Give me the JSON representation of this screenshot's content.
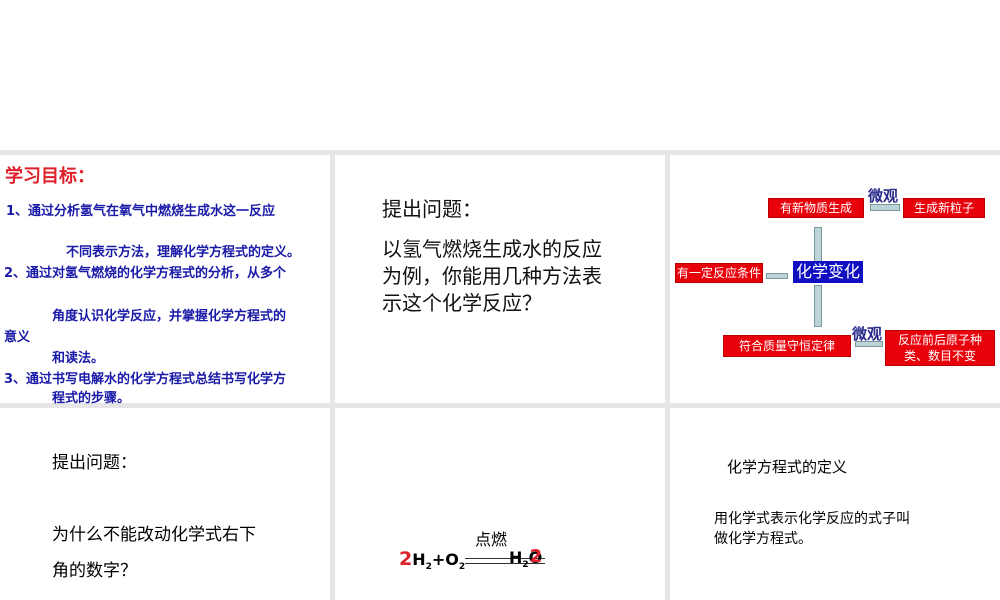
{
  "slide1": {
    "title": "学习目标：",
    "lines": [
      "1、通过分析氢气在氧气中燃烧生成水这一反应",
      "不同表示方法，理解化学方程式的定义。",
      "2、通过对氢气燃烧的化学方程式的分析，从多个",
      "角度认识化学反应，并掌握化学方程式的",
      "意义",
      "和读法。",
      "3、通过书写电解水的化学方程式总结书写化学方",
      "程式的步骤。"
    ]
  },
  "slide2": {
    "heading": "提出问题：",
    "lines": [
      "以氢气燃烧生成水的反应",
      "为例，你能用几种方法表",
      "示这个化学反应？"
    ]
  },
  "slide3": {
    "center": "化学变化",
    "top": "有新物质生成",
    "top_right": "生成新粒子",
    "left": "有一定反应条件",
    "bottom": "符合质量守恒定律",
    "bottom_right_1": "反应前后原子种",
    "bottom_right_2": "类、数目不变",
    "micro_top": "微观",
    "micro_bottom": "微观",
    "colors": {
      "red": "#e8000b",
      "blue": "#1010c0"
    }
  },
  "slide4": {
    "heading": "提出问题：",
    "lines": [
      "为什么不能改动化学式右下",
      "角的数字？"
    ]
  },
  "slide5": {
    "condition": "点燃",
    "coef": "2",
    "h": "H",
    "sub2": "2",
    "plus": "+O",
    "sub2b": "2",
    "product_h": "H",
    "product_sub": "2",
    "product_o": "O",
    "product_coef": "2"
  },
  "slide6": {
    "title": "化学方程式的定义",
    "lines": [
      "用化学式表示化学反应的式子叫",
      "做化学方程式。"
    ]
  }
}
